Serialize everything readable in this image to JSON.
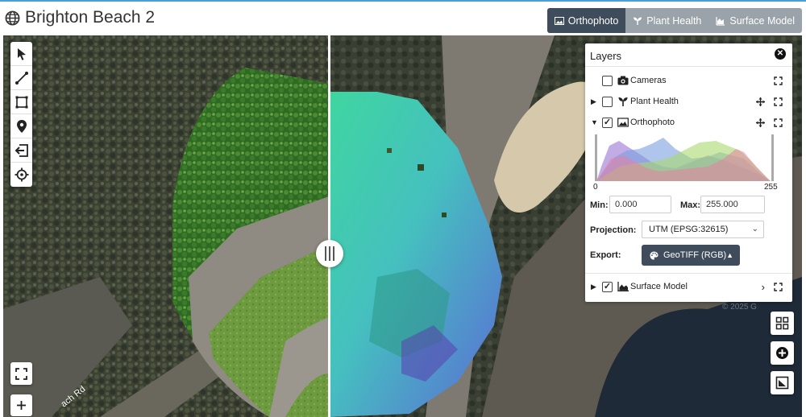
{
  "header": {
    "title": "Brighton Beach 2",
    "tabs": [
      {
        "label": "Orthophoto",
        "icon": "image-icon",
        "active": true
      },
      {
        "label": "Plant Health",
        "icon": "plant-icon",
        "active": false
      },
      {
        "label": "Surface Model",
        "icon": "area-chart-icon",
        "active": false
      }
    ]
  },
  "map": {
    "road_label": "ach Rd",
    "attribution": "© 2025 G"
  },
  "toolbar": {
    "tools": [
      "select-arrow-icon",
      "measure-line-icon",
      "measure-area-icon",
      "marker-icon",
      "export-icon",
      "locate-icon"
    ]
  },
  "layers": {
    "title": "Layers",
    "items": [
      {
        "label": "Cameras",
        "checked": false
      },
      {
        "label": "Plant Health",
        "checked": false
      },
      {
        "label": "Orthophoto",
        "checked": true
      },
      {
        "label": "Surface Model",
        "checked": true
      }
    ],
    "hist_min_tick": "0",
    "hist_max_tick": "255",
    "min_label": "Min:",
    "min_value": "0.000",
    "max_label": "Max:",
    "max_value": "255.000",
    "projection_label": "Projection:",
    "projection_value": "UTM (EPSG:32615)",
    "export_label": "Export:",
    "export_value": "GeoTIFF (RGB)"
  },
  "colors": {
    "header_active": "#3e4c5b",
    "header_inactive": "#9aa3a9",
    "accent": "#4aa0d5"
  }
}
